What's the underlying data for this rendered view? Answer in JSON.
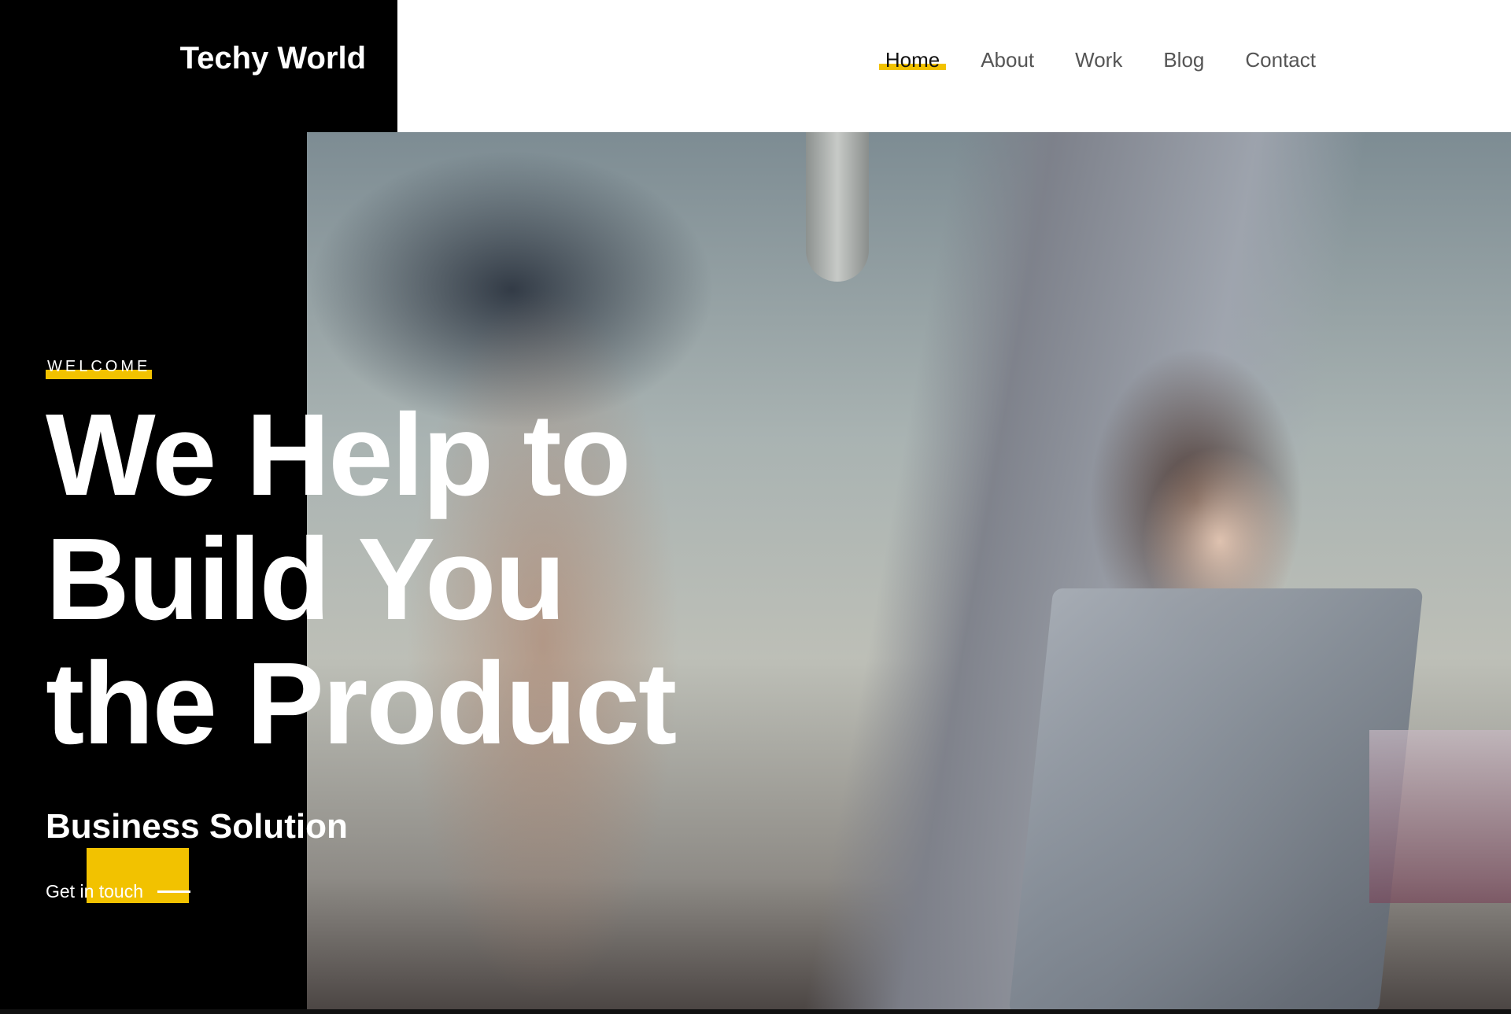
{
  "brand": {
    "name": "Techy World"
  },
  "nav": {
    "items": [
      {
        "label": "Home",
        "active": true
      },
      {
        "label": "About",
        "active": false
      },
      {
        "label": "Work",
        "active": false
      },
      {
        "label": "Blog",
        "active": false
      },
      {
        "label": "Contact",
        "active": false
      }
    ]
  },
  "hero": {
    "kicker": "WELCOME",
    "headline": "We Help to\nBuild You\nthe Product",
    "subhead": "Business Solution",
    "cta_label": "Get in touch",
    "image": "hero-photo-woman-laptop"
  },
  "colors": {
    "accent": "#f2c200",
    "dark": "#000000",
    "nav_text": "#555555",
    "active_text": "#111111"
  },
  "icons": [
    "cta-arrow-line-icon"
  ]
}
